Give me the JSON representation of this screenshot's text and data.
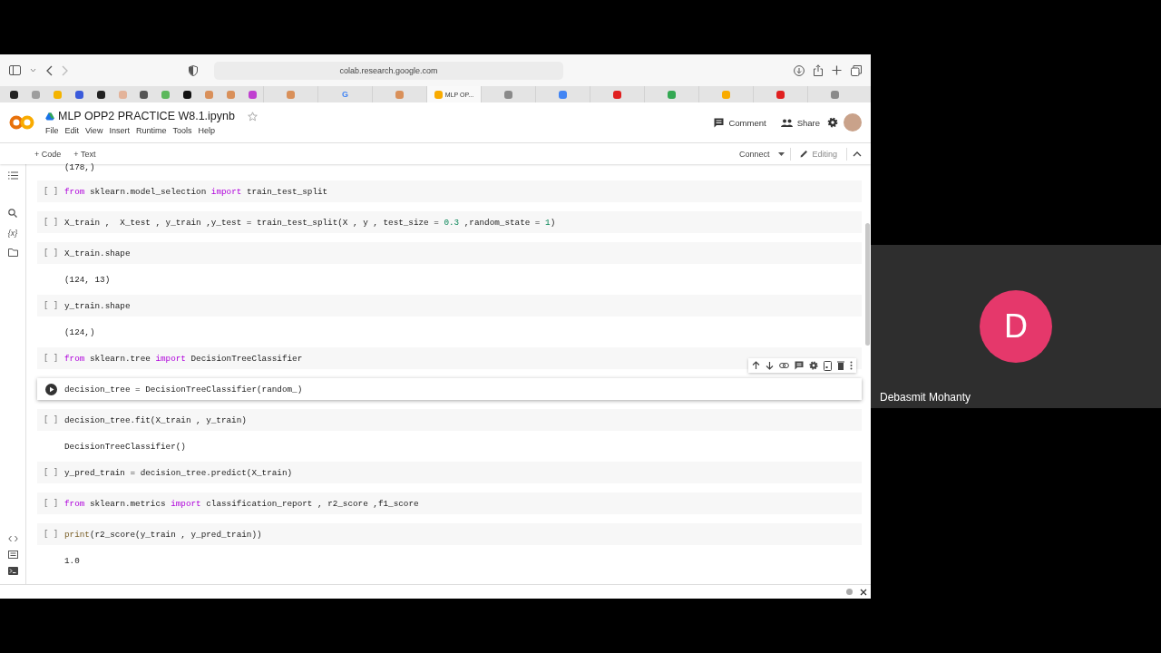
{
  "browser": {
    "url": "colab.research.google.com"
  },
  "tabs": [
    {
      "kind": "pinned",
      "color": "#222222"
    },
    {
      "kind": "pinned",
      "color": "#9e9e9e"
    },
    {
      "kind": "pinned",
      "color": "#f4b400"
    },
    {
      "kind": "pinned",
      "color": "#3b5bdb"
    },
    {
      "kind": "pinned",
      "color": "#222222"
    },
    {
      "kind": "pinned",
      "color": "#e3b39a"
    },
    {
      "kind": "pinned",
      "color": "#555555"
    },
    {
      "kind": "pinned",
      "color": "#5cb85c"
    },
    {
      "kind": "pinned",
      "color": "#111111"
    },
    {
      "kind": "pinned",
      "color": "#d9905a"
    },
    {
      "kind": "pinned",
      "color": "#d9905a"
    },
    {
      "kind": "pinned",
      "color": "#c040d0"
    },
    {
      "kind": "tab",
      "color": "#d9905a",
      "selected": false
    },
    {
      "kind": "tab",
      "color": "#4285f4",
      "glyph": "G",
      "selected": false
    },
    {
      "kind": "tab",
      "color": "#d9905a",
      "selected": false
    },
    {
      "kind": "tab",
      "color": "#f9ab00",
      "title": "MLP OP...",
      "selected": true
    },
    {
      "kind": "tab",
      "color": "#8a8a8a",
      "selected": false
    },
    {
      "kind": "tab",
      "color": "#4285f4",
      "selected": false
    },
    {
      "kind": "tab",
      "color": "#e02020",
      "selected": false
    },
    {
      "kind": "tab",
      "color": "#34a853",
      "selected": false
    },
    {
      "kind": "tab",
      "color": "#f9ab00",
      "selected": false
    },
    {
      "kind": "tab",
      "color": "#e02020",
      "selected": false
    },
    {
      "kind": "tab",
      "color": "#8a8a8a",
      "selected": false
    }
  ],
  "notebook": {
    "title": "MLP OPP2 PRACTICE W8.1.ipynb",
    "menu": [
      "File",
      "Edit",
      "View",
      "Insert",
      "Runtime",
      "Tools",
      "Help"
    ],
    "comment": "Comment",
    "share": "Share"
  },
  "toolbar": {
    "add_buttons": [
      "+ Code",
      "+ Text"
    ],
    "connect": "Connect",
    "mode": "Editing"
  },
  "sidebar": {
    "variables_icon": "{x}"
  },
  "leading_output": "(178,)",
  "cells": [
    {
      "prompt": "[ ]",
      "selected": false,
      "code": [
        {
          "text": "from",
          "kind": "keyword"
        },
        {
          "text": " sklearn.model_selection ",
          "kind": "plain"
        },
        {
          "text": "import",
          "kind": "keyword"
        },
        {
          "text": " train_test_split",
          "kind": "plain"
        }
      ]
    },
    {
      "prompt": "[ ]",
      "selected": false,
      "code": [
        {
          "text": "X_train ,  X_test , y_train ,y_test = train_test_split(X , y , test_size = ",
          "kind": "plain"
        },
        {
          "text": "0.3",
          "kind": "number"
        },
        {
          "text": " ,random_state = ",
          "kind": "plain"
        },
        {
          "text": "1",
          "kind": "number"
        },
        {
          "text": ")",
          "kind": "plain"
        }
      ]
    },
    {
      "prompt": "[ ]",
      "selected": false,
      "code": [
        {
          "text": "X_train.shape",
          "kind": "plain"
        }
      ],
      "output": "(124, 13)"
    },
    {
      "prompt": "[ ]",
      "selected": false,
      "code": [
        {
          "text": "y_train.shape",
          "kind": "plain"
        }
      ],
      "output": "(124,)"
    },
    {
      "prompt": "[ ]",
      "selected": false,
      "code": [
        {
          "text": "from",
          "kind": "keyword"
        },
        {
          "text": " sklearn.tree ",
          "kind": "plain"
        },
        {
          "text": "import",
          "kind": "keyword"
        },
        {
          "text": " DecisionTreeClassifier",
          "kind": "plain"
        }
      ]
    },
    {
      "selected": true,
      "code": [
        {
          "text": "decision_tree = DecisionTreeClassifier(random_)",
          "kind": "plain"
        }
      ]
    },
    {
      "prompt": "[ ]",
      "selected": false,
      "code": [
        {
          "text": "decision_tree.fit(X_train , y_train)",
          "kind": "plain"
        }
      ],
      "output": "DecisionTreeClassifier()"
    },
    {
      "prompt": "[ ]",
      "selected": false,
      "code": [
        {
          "text": "y_pred_train = decision_tree.predict(X_train)",
          "kind": "plain"
        }
      ]
    },
    {
      "prompt": "[ ]",
      "selected": false,
      "code": [
        {
          "text": "from",
          "kind": "keyword"
        },
        {
          "text": " sklearn.metrics ",
          "kind": "plain"
        },
        {
          "text": "import",
          "kind": "keyword"
        },
        {
          "text": " classification_report , r2_score ,f1_score",
          "kind": "plain"
        }
      ]
    },
    {
      "prompt": "[ ]",
      "selected": false,
      "code": [
        {
          "text": "print",
          "kind": "builtin"
        },
        {
          "text": "(r2_score(y_train , y_pred_train))",
          "kind": "plain"
        }
      ],
      "output": "1.0"
    }
  ],
  "participant": {
    "name": "Debasmit Mohanty",
    "initial": "D",
    "color": "#e5386b"
  }
}
